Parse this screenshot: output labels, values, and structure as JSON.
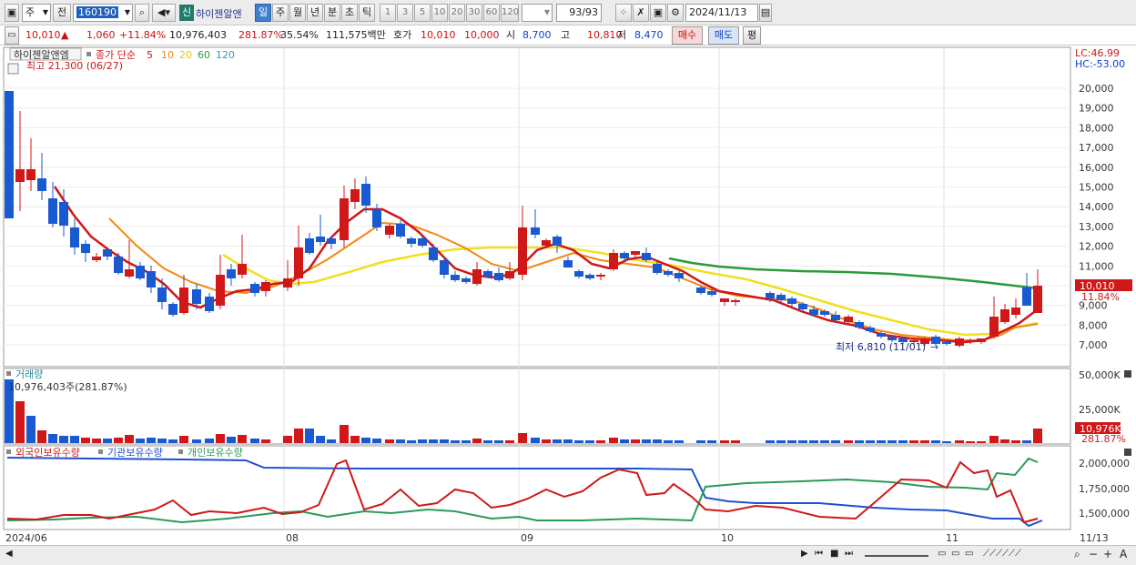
{
  "toolbar": {
    "market": "주",
    "prev_label": "전",
    "stock_code": "160190",
    "new_badge": "신",
    "stock_name": "하이젠알앤",
    "periods": [
      "일",
      "주",
      "월",
      "년",
      "분",
      "초",
      "틱"
    ],
    "active_period": "일",
    "intervals": [
      "1",
      "3",
      "5",
      "10",
      "20",
      "30",
      "60",
      "120"
    ],
    "count": "93",
    "count_total": "/93",
    "date": "2024/11/13"
  },
  "quote": {
    "price": "10,010",
    "change": "1,060",
    "change_pct": "+11.84%",
    "volume": "10,976,403",
    "volume_ratio": "281.87%",
    "turnover": "35.54%",
    "amount": "111,575백만",
    "bid_label": "호가",
    "bid": "10,010",
    "ask": "10,000",
    "open_label": "시",
    "open": "8,700",
    "high_label": "고",
    "high": "10,810",
    "low_label": "저",
    "low": "8,470",
    "buy_btn": "매수",
    "sell_btn": "매도",
    "eval_btn": "평"
  },
  "price_panel": {
    "title": "하이젠알앤엠",
    "ma_label": "종가 단순",
    "ma_periods": [
      "5",
      "10",
      "20",
      "60",
      "120"
    ],
    "ma_colors": [
      "#d01818",
      "#f08a10",
      "#f0e020",
      "#2a9a3a",
      "#2aa0c0"
    ],
    "high_note": "최고 21,300 (06/27)",
    "low_note": "최저 6,810 (11/01)",
    "lc": "LC:46.99",
    "hc": "HC:-53.00",
    "price_tag": "10,010",
    "pct_tag": "11.84%",
    "y_ticks": [
      "20,000",
      "19,000",
      "18,000",
      "17,000",
      "16,000",
      "15,000",
      "14,000",
      "13,000",
      "12,000",
      "11,000",
      "10,000",
      "9,000",
      "8,000",
      "7,000"
    ]
  },
  "volume_panel": {
    "title": "거래량",
    "value_note": "10,976,403주(281.87%)",
    "y_ticks": [
      "50,000K",
      "25,000K"
    ],
    "tag": "10,976K",
    "tag_pct": "281.87%"
  },
  "holdings_panel": {
    "series": [
      "외국인보유수량",
      "기관보유수량",
      "개인보유수량"
    ],
    "colors": [
      "#d01818",
      "#2050d0",
      "#2a9a5a"
    ],
    "y_ticks": [
      "2,000,000",
      "1,750,000",
      "1,500,000"
    ]
  },
  "x_axis": {
    "labels": [
      "2024/06",
      "08",
      "09",
      "10",
      "11"
    ],
    "end_label": "11/13"
  }
}
